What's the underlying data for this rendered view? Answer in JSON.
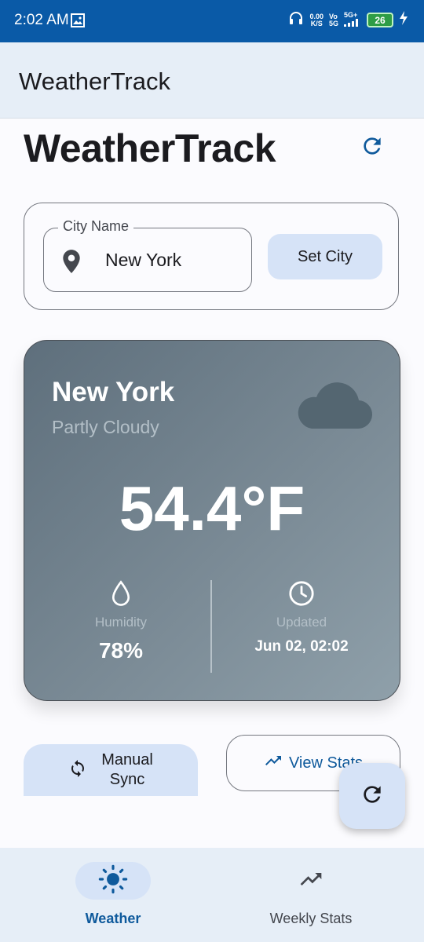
{
  "status_bar": {
    "time": "2:02 AM",
    "net_speed_top": "0.00",
    "net_speed_bottom": "K/S",
    "volte_top": "Vo",
    "volte_bottom": "5G",
    "network_type": "5G+",
    "battery": "26"
  },
  "app_bar": {
    "title": "WeatherTrack"
  },
  "header": {
    "title": "WeatherTrack",
    "refresh_icon": "refresh-icon"
  },
  "city_input": {
    "label": "City Name",
    "value": "New York",
    "icon": "location-pin-icon",
    "button_label": "Set City"
  },
  "weather": {
    "city": "New York",
    "condition": "Partly Cloudy",
    "condition_icon": "cloud-icon",
    "temperature": "54.4°F",
    "humidity_label": "Humidity",
    "humidity_value": "78%",
    "updated_label": "Updated",
    "updated_value": "Jun 02, 02:02"
  },
  "actions": {
    "manual_sync_line1": "Manual",
    "manual_sync_line2": "Sync",
    "view_stats_label": "View Stats"
  },
  "bottom_nav": {
    "items": [
      {
        "label": "Weather",
        "icon": "sun-icon",
        "active": true
      },
      {
        "label": "Weekly Stats",
        "icon": "trending-up-icon",
        "active": false
      }
    ]
  },
  "colors": {
    "status_bar": "#0a5aa7",
    "app_bar": "#e6eef7",
    "accent": "#0f5a9c",
    "tonal_button": "#d6e3f7"
  }
}
